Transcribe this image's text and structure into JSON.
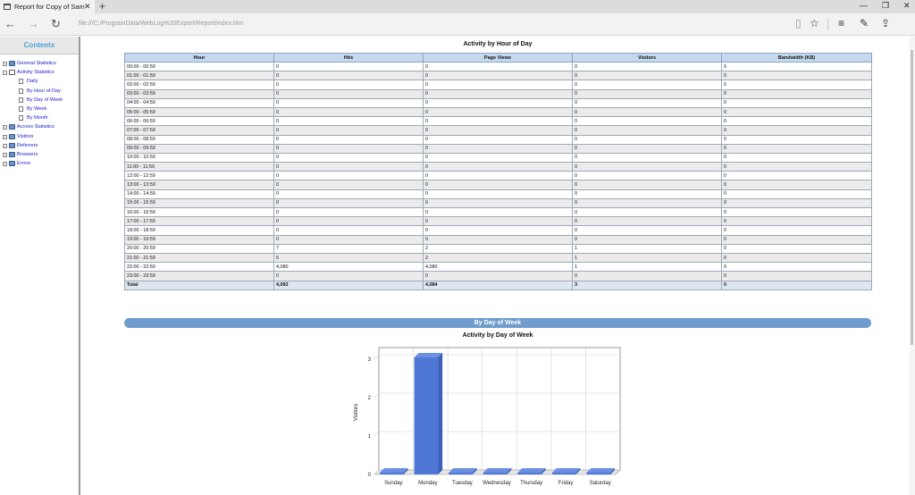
{
  "browser": {
    "tab_title": "Report for Copy of Sam",
    "tab_close": "✕",
    "new_tab": "+",
    "url": "file:///C:/ProgramData/WebLog%20Expert/Report/index.htm",
    "back": "←",
    "forward": "→",
    "refresh": "↻",
    "reading_view": "▯",
    "favorite": "☆",
    "hub": "≡",
    "web_note": "✎",
    "share": "⇪",
    "minimize": "—",
    "restore": "❐",
    "close": "✕"
  },
  "sidebar": {
    "heading": "Contents",
    "items": [
      {
        "label": "General Statistics",
        "level": 0,
        "expander": "+"
      },
      {
        "label": "Activity Statistics",
        "level": 0,
        "expander": "−",
        "open": true
      },
      {
        "label": "Daily",
        "level": 1
      },
      {
        "label": "By Hour of Day",
        "level": 1
      },
      {
        "label": "By Day of Week",
        "level": 1
      },
      {
        "label": "By Week",
        "level": 1
      },
      {
        "label": "By Month",
        "level": 1
      },
      {
        "label": "Access Statistics",
        "level": 0,
        "expander": "+"
      },
      {
        "label": "Visitors",
        "level": 0,
        "expander": "+"
      },
      {
        "label": "Referrers",
        "level": 0,
        "expander": "+"
      },
      {
        "label": "Browsers",
        "level": 0,
        "expander": "+"
      },
      {
        "label": "Errors",
        "level": 0,
        "expander": "+"
      }
    ]
  },
  "hour_table": {
    "title": "Activity by Hour of Day",
    "columns": [
      "Hour",
      "Hits",
      "Page Views",
      "Visitors",
      "Bandwidth (KB)"
    ],
    "rows": [
      [
        "00:00 - 00:59",
        "0",
        "0",
        "0",
        "0"
      ],
      [
        "01:00 - 01:59",
        "0",
        "0",
        "0",
        "0"
      ],
      [
        "02:00 - 02:59",
        "0",
        "0",
        "0",
        "0"
      ],
      [
        "03:00 - 03:59",
        "0",
        "0",
        "0",
        "0"
      ],
      [
        "04:00 - 04:59",
        "0",
        "0",
        "0",
        "0"
      ],
      [
        "05:00 - 05:59",
        "0",
        "0",
        "0",
        "0"
      ],
      [
        "06:00 - 06:59",
        "0",
        "0",
        "0",
        "0"
      ],
      [
        "07:00 - 07:59",
        "0",
        "0",
        "0",
        "0"
      ],
      [
        "08:00 - 08:59",
        "0",
        "0",
        "0",
        "0"
      ],
      [
        "09:00 - 09:59",
        "0",
        "0",
        "0",
        "0"
      ],
      [
        "10:00 - 10:59",
        "0",
        "0",
        "0",
        "0"
      ],
      [
        "11:00 - 11:59",
        "0",
        "0",
        "0",
        "0"
      ],
      [
        "12:00 - 12:59",
        "0",
        "0",
        "0",
        "0"
      ],
      [
        "13:00 - 13:59",
        "0",
        "0",
        "0",
        "0"
      ],
      [
        "14:00 - 14:59",
        "0",
        "0",
        "0",
        "0"
      ],
      [
        "15:00 - 15:59",
        "0",
        "0",
        "0",
        "0"
      ],
      [
        "16:00 - 16:59",
        "0",
        "0",
        "0",
        "0"
      ],
      [
        "17:00 - 17:59",
        "0",
        "0",
        "0",
        "0"
      ],
      [
        "18:00 - 18:59",
        "0",
        "0",
        "0",
        "0"
      ],
      [
        "19:00 - 19:59",
        "0",
        "0",
        "0",
        "0"
      ],
      [
        "20:00 - 20:59",
        "7",
        "2",
        "1",
        "0"
      ],
      [
        "21:00 - 21:59",
        "5",
        "2",
        "1",
        "0"
      ],
      [
        "22:00 - 22:59",
        "4,080",
        "4,080",
        "1",
        "0"
      ],
      [
        "23:00 - 23:59",
        "0",
        "0",
        "0",
        "0"
      ]
    ],
    "total": [
      "Total",
      "4,092",
      "4,084",
      "3",
      "0"
    ]
  },
  "day_section": {
    "bar_label": "By Day of Week"
  },
  "chart_data": {
    "type": "bar",
    "title": "Activity by Day of Week",
    "categories": [
      "Sunday",
      "Monday",
      "Tuesday",
      "Wednesday",
      "Thursday",
      "Friday",
      "Saturday"
    ],
    "values": [
      0,
      3,
      0,
      0,
      0,
      0,
      0
    ],
    "ylabel": "Visitors",
    "ylim": [
      0,
      3
    ],
    "yticks": [
      "0",
      "1",
      "2",
      "3"
    ],
    "grid": true,
    "bar_color": "#4f77d6"
  }
}
